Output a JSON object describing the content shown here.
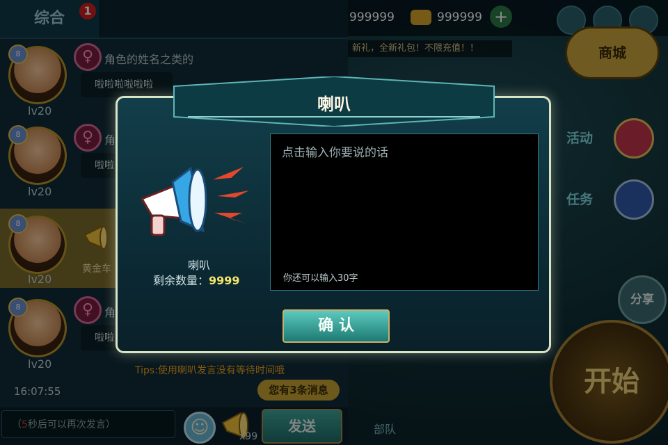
{
  "topbar": {
    "currency1": "999999",
    "currency2": "999999",
    "marquee": "新礼，全新礼包！不限充值！！"
  },
  "side": {
    "shop": "商城",
    "activity": "活动",
    "task": "任务",
    "share": "分享",
    "start": "开始",
    "team": "部队"
  },
  "chat": {
    "tab": "综合",
    "tab_badge": "1",
    "messages": [
      {
        "level": "lv20",
        "name": "角色的姓名之类的",
        "text": "啦啦啦啦啦啦"
      },
      {
        "level": "lv20",
        "name": "角",
        "text": "啦啦"
      },
      {
        "level": "lv20",
        "prize": "黄金车"
      },
      {
        "level": "lv20",
        "name": "角",
        "text": "啦啦"
      }
    ],
    "time": "16:07:55",
    "unread": "您有3条消息",
    "input_placeholder_pre": "（",
    "input_placeholder_num": "5",
    "input_placeholder_post": "秒后可以再次发言）",
    "horn_count": "x99",
    "send": "发送",
    "tips": "Tips:使用喇叭发言没有等待时间哦"
  },
  "dialog": {
    "title": "喇叭",
    "item_name": "喇叭",
    "remain_label": "剩余数量：",
    "remain_value": "9999",
    "placeholder": "点击输入你要说的话",
    "counter": "你还可以输入30字",
    "confirm": "确 认"
  },
  "colors": {
    "accent": "#c7a334",
    "panel": "#0f2d38",
    "confirm": "#2a9a8f",
    "remain": "#f3e46a"
  },
  "icons": [
    "female-icon",
    "megaphone-icon",
    "emoji-icon",
    "gift-icon",
    "book-icon",
    "plus-icon"
  ]
}
